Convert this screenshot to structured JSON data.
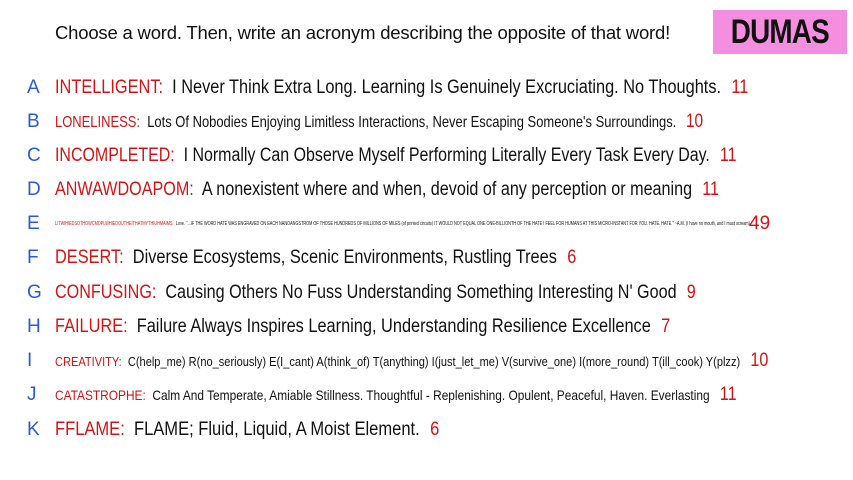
{
  "prompt": "Choose a word. Then, write an acronym describing the opposite of that word!",
  "badge": "DUMAS",
  "colors": {
    "letter": "#2a5bd7",
    "word": "#d21414",
    "badge_bg": "#f48fe0"
  },
  "rows": [
    {
      "letter": "A",
      "word": "INTELLIGENT",
      "acronym": "I Never Think Extra Long. Learning Is Genuinely Excruciating. No Thoughts.",
      "count": "11"
    },
    {
      "letter": "B",
      "word": "LONELINESS",
      "acronym": "Lots Of Nobodies Enjoying Limitless Interactions, Never Escaping Someone's Surroundings.",
      "count": "10"
    },
    {
      "letter": "C",
      "word": "INCOMPLETED",
      "acronym": "I Normally Can Observe Myself Performing Literally Every Task Every Day.",
      "count": "11"
    },
    {
      "letter": "D",
      "word": "ANWAWDOAPOM",
      "acronym": "A nonexistent where and when, devoid of any perception or meaning",
      "count": "11"
    },
    {
      "letter": "E",
      "word": "LITWIHIEDSOTHOWCMOPLWHIEDOUTHEITHATMYTHIUHMAIMS",
      "acronym": "Love. \"...IF THE WORD HATE WAS ENGRAVED ON EACH NANOANGSTROM OF THOSE HUNDREDS OF MILLIONS OF MILES (of printed circuits) IT WOULD NOT EQUAL ONE ONE-BILLIONTH OF THE HATE I FEEL FOR HUMANS AT THIS MICRO-INSTANT FOR YOU. HATE. HATE.\" ~A.M. (I have no mouth, and I must scream)",
      "count": "49"
    },
    {
      "letter": "F",
      "word": "DESERT",
      "acronym": "Diverse Ecosystems, Scenic Environments, Rustling Trees",
      "count": "6"
    },
    {
      "letter": "G",
      "word": "CONFUSING",
      "acronym": "Causing Others No Fuss Understanding Something Interesting N' Good",
      "count": "9"
    },
    {
      "letter": "H",
      "word": "FAILURE",
      "acronym": "Failure Always Inspires Learning, Understanding Resilience Excellence",
      "count": "7"
    },
    {
      "letter": "I",
      "word": "CREATIVITY",
      "acronym": "C(help_me) R(no_seriously) E(I_cant) A(think_of) T(anything) I(just_let_me) V(survive_one) I(more_round) T(ill_cook) Y(plzz)",
      "count": "10"
    },
    {
      "letter": "J",
      "word": "CATASTROPHE",
      "acronym": "Calm And Temperate, Amiable Stillness. Thoughtful - Replenishing. Opulent, Peaceful, Haven. Everlasting",
      "count": "11"
    },
    {
      "letter": "K",
      "word": "FFLAME",
      "acronym": "FLAME; Fluid, Liquid, A Moist Element.",
      "count": "6"
    }
  ]
}
